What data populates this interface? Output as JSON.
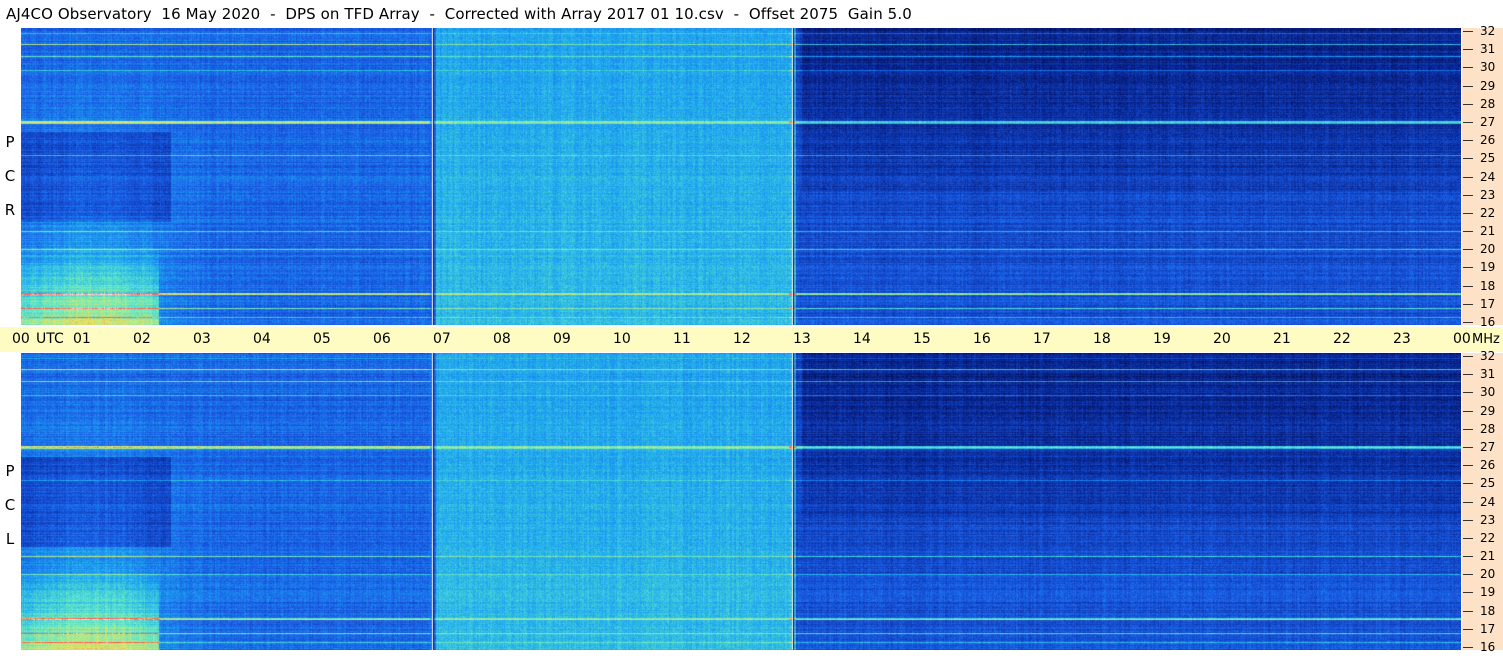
{
  "title": "AJ4CO Observatory  16 May 2020  -  DPS on TFD Array  -  Corrected with Array 2017 01 10.csv  -  Offset 2075  Gain 5.0",
  "panels": [
    {
      "polarization": "RCP",
      "letters": [
        "R",
        "C",
        "P"
      ]
    },
    {
      "polarization": "LCP",
      "letters": [
        "L",
        "C",
        "P"
      ]
    }
  ],
  "chart_data": {
    "type": "heatmap",
    "title": "AJ4CO Observatory  16 May 2020  -  DPS on TFD Array  -  Corrected with Array 2017 01 10.csv  -  Offset 2075  Gain 5.0",
    "xlabel": "UTC",
    "ylabel": "MHz",
    "x_ticks": [
      "00",
      "01",
      "02",
      "03",
      "04",
      "05",
      "06",
      "07",
      "08",
      "09",
      "10",
      "11",
      "12",
      "13",
      "14",
      "15",
      "16",
      "17",
      "18",
      "19",
      "20",
      "21",
      "22",
      "23",
      "00"
    ],
    "y_ticks": [
      32,
      31,
      30,
      29,
      28,
      27,
      26,
      25,
      24,
      23,
      22,
      21,
      20,
      19,
      18,
      17,
      16
    ],
    "xlim": [
      0,
      24
    ],
    "ylim": [
      16,
      32
    ],
    "panels": [
      "RCP",
      "LCP"
    ],
    "vertical_markers_utc": [
      6.87,
      12.87
    ],
    "colormap": [
      "#000033",
      "#0a2a9a",
      "#1a5ee8",
      "#1ea8f0",
      "#5ee8c8",
      "#e8e860",
      "#ff4040",
      "#ffffff"
    ]
  }
}
